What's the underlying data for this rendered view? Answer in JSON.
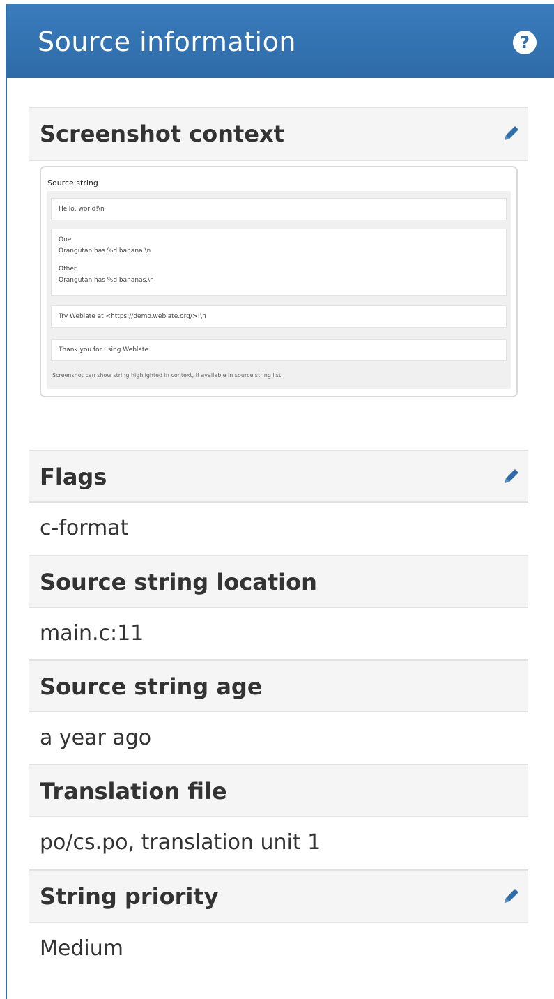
{
  "panel": {
    "title": "Source information",
    "help_icon": "question-circle-icon",
    "accent_color": "#3274b4"
  },
  "screenshot_context": {
    "label": "Screenshot context",
    "edit_icon": "pencil-icon",
    "thumbnail": {
      "title": "Source string",
      "items": [
        "Hello, world!\\n",
        "One",
        "Orangutan has %d banana.\\n",
        "Other",
        "Orangutan has %d bananas.\\n",
        "Try Weblate at <https://demo.weblate.org/>!\\n",
        "Thank you for using Weblate."
      ],
      "footer": "Screenshot can show string highlighted in context, if available in source string list."
    }
  },
  "flags": {
    "label": "Flags",
    "value": "c-format",
    "edit_icon": "pencil-icon"
  },
  "location": {
    "label": "Source string location",
    "value": "main.c:11"
  },
  "age": {
    "label": "Source string age",
    "value": "a year ago"
  },
  "file": {
    "label": "Translation file",
    "value": "po/cs.po, translation unit 1"
  },
  "priority": {
    "label": "String priority",
    "value": "Medium",
    "edit_icon": "pencil-icon"
  }
}
